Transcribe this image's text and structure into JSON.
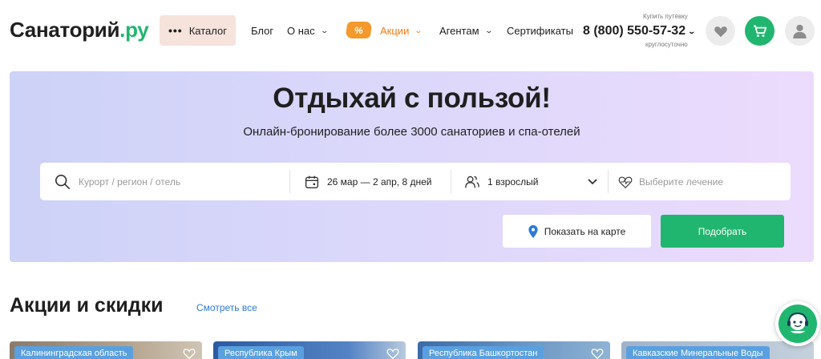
{
  "header": {
    "logo_main": "Санаторий",
    "logo_suffix": ".ру",
    "catalog_label": "Каталог",
    "nav": {
      "blog": "Блог",
      "about": "О нас",
      "promo_badge": "%",
      "promo": "Акции",
      "agents": "Агентам",
      "certificates": "Сертификаты"
    },
    "phone_caption": "Купить путёвку",
    "phone": "8 (800) 550-57-32",
    "phone_hours": "круглосуточно"
  },
  "hero": {
    "title": "Отдыхай с пользой!",
    "subtitle": "Онлайн-бронирование более 3000 санаториев и спа-отелей",
    "search": {
      "place_placeholder": "Курорт / регион / отель",
      "dates": "26 мар — 2 апр, 8 дней",
      "guests": "1 взрослый",
      "treatment_placeholder": "Выберите лечение"
    },
    "map_button": "Показать на карте",
    "pick_button": "Подобрать"
  },
  "promo_section": {
    "title": "Акции и скидки",
    "see_all": "Смотреть все",
    "cards": [
      {
        "region": "Калининградская область"
      },
      {
        "region": "Республика Крым"
      },
      {
        "region": "Республика Башкортостан"
      },
      {
        "region": "Кавказские Минеральные Воды"
      }
    ]
  },
  "colors": {
    "brand_green": "#21b66f",
    "promo_orange": "#f07b1a",
    "link_blue": "#2a7ad8",
    "catalog_bg": "#f6e3dc",
    "tag_blue": "#5aa0e0"
  },
  "icons": [
    "dots-icon",
    "chevron-down-icon",
    "heart-icon",
    "cart-icon",
    "user-icon",
    "search-icon",
    "calendar-icon",
    "guests-icon",
    "heartbeat-icon",
    "map-pin-icon",
    "chat-operator-icon"
  ]
}
